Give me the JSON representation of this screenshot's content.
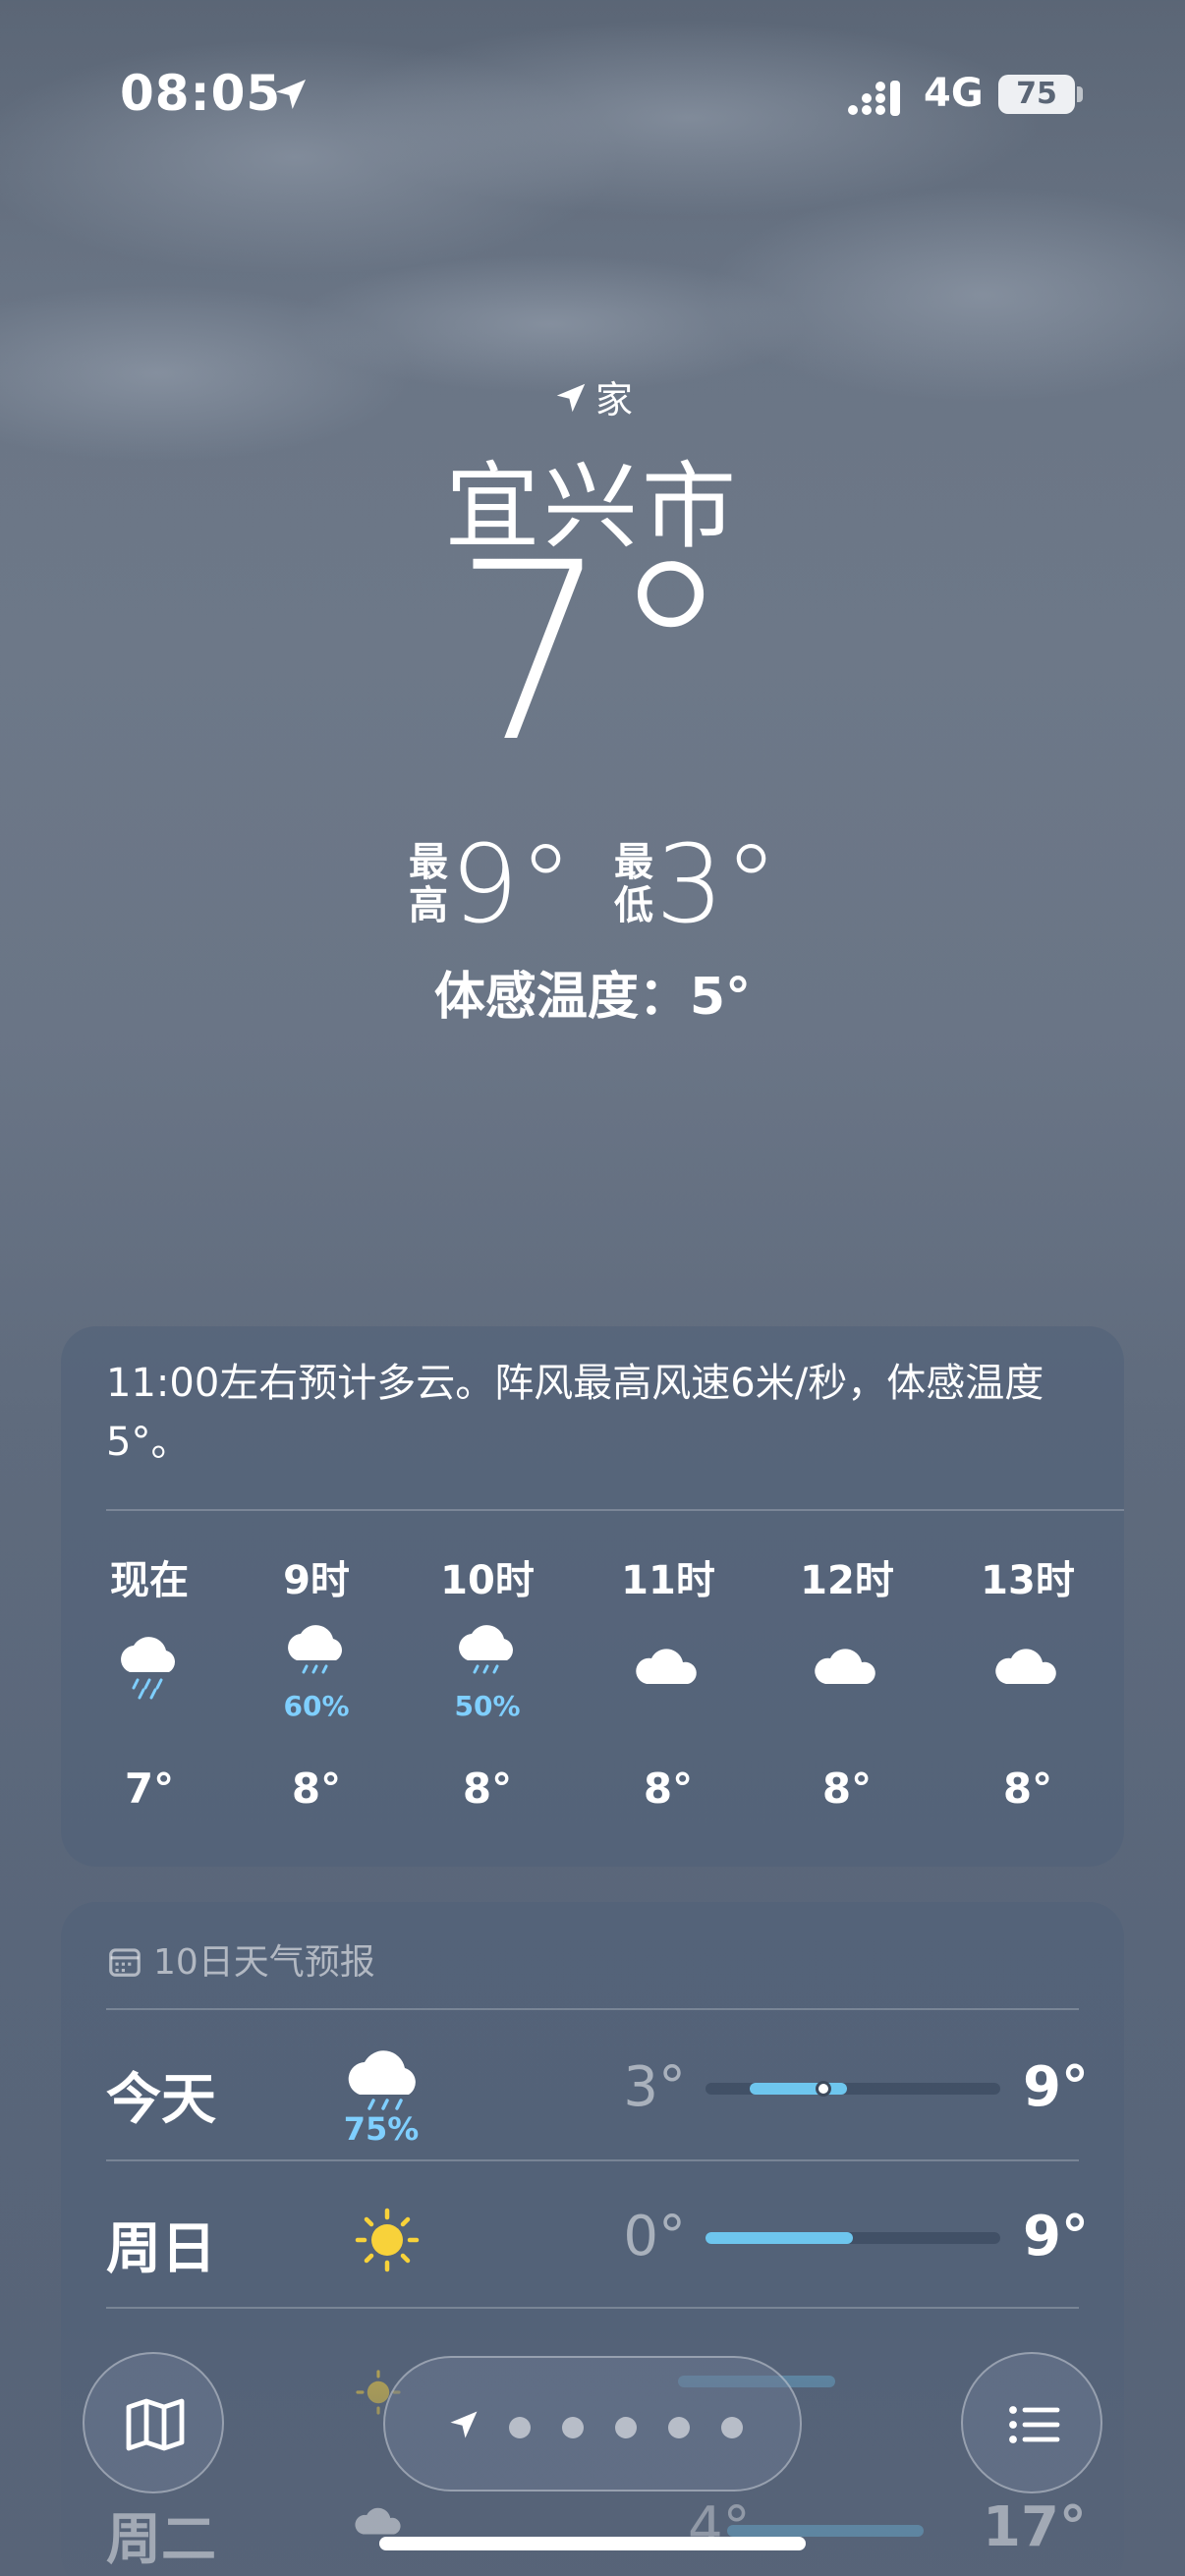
{
  "status_bar": {
    "time": "08:05",
    "network": "4G",
    "battery": "75"
  },
  "location": {
    "home_label": "家",
    "city": "宜兴市",
    "current_temp": "7°",
    "high_label": "最高",
    "high": "9°",
    "low_label": "最低",
    "low": "3°",
    "feels_like": "体感温度：5°"
  },
  "hourly": {
    "summary": "11:00左右预计多云。阵风最高风速6米/秒，体感温度5°。",
    "items": [
      {
        "label": "现在",
        "icon": "cloud-rain-icon",
        "precip": "",
        "temp": "7°"
      },
      {
        "label": "9时",
        "icon": "cloud-rain-icon",
        "precip": "60%",
        "temp": "8°"
      },
      {
        "label": "10时",
        "icon": "cloud-rain-icon",
        "precip": "50%",
        "temp": "8°"
      },
      {
        "label": "11时",
        "icon": "cloud-icon",
        "precip": "",
        "temp": "8°"
      },
      {
        "label": "12时",
        "icon": "cloud-icon",
        "precip": "",
        "temp": "8°"
      },
      {
        "label": "13时",
        "icon": "cloud-icon",
        "precip": "",
        "temp": "8°"
      }
    ]
  },
  "forecast": {
    "title": "10日天气预报",
    "days": [
      {
        "name": "今天",
        "icon": "cloud-rain-icon",
        "precip": "75%",
        "low": "3°",
        "high": "9°",
        "bar_start": 0.15,
        "bar_end": 0.48,
        "current_marker": 0.4
      },
      {
        "name": "周日",
        "icon": "sun-icon",
        "precip": "",
        "low": "0°",
        "high": "9°",
        "bar_start": 0.0,
        "bar_end": 0.5
      }
    ],
    "partial_next": {
      "name": "周二",
      "low": "4°",
      "high": "17°"
    }
  },
  "toolbar": {
    "map": "map-icon",
    "list": "list-icon",
    "pager_dots": 5
  },
  "colors": {
    "precip": "#7fcfff",
    "temp_bar": "#6ec6ee"
  }
}
